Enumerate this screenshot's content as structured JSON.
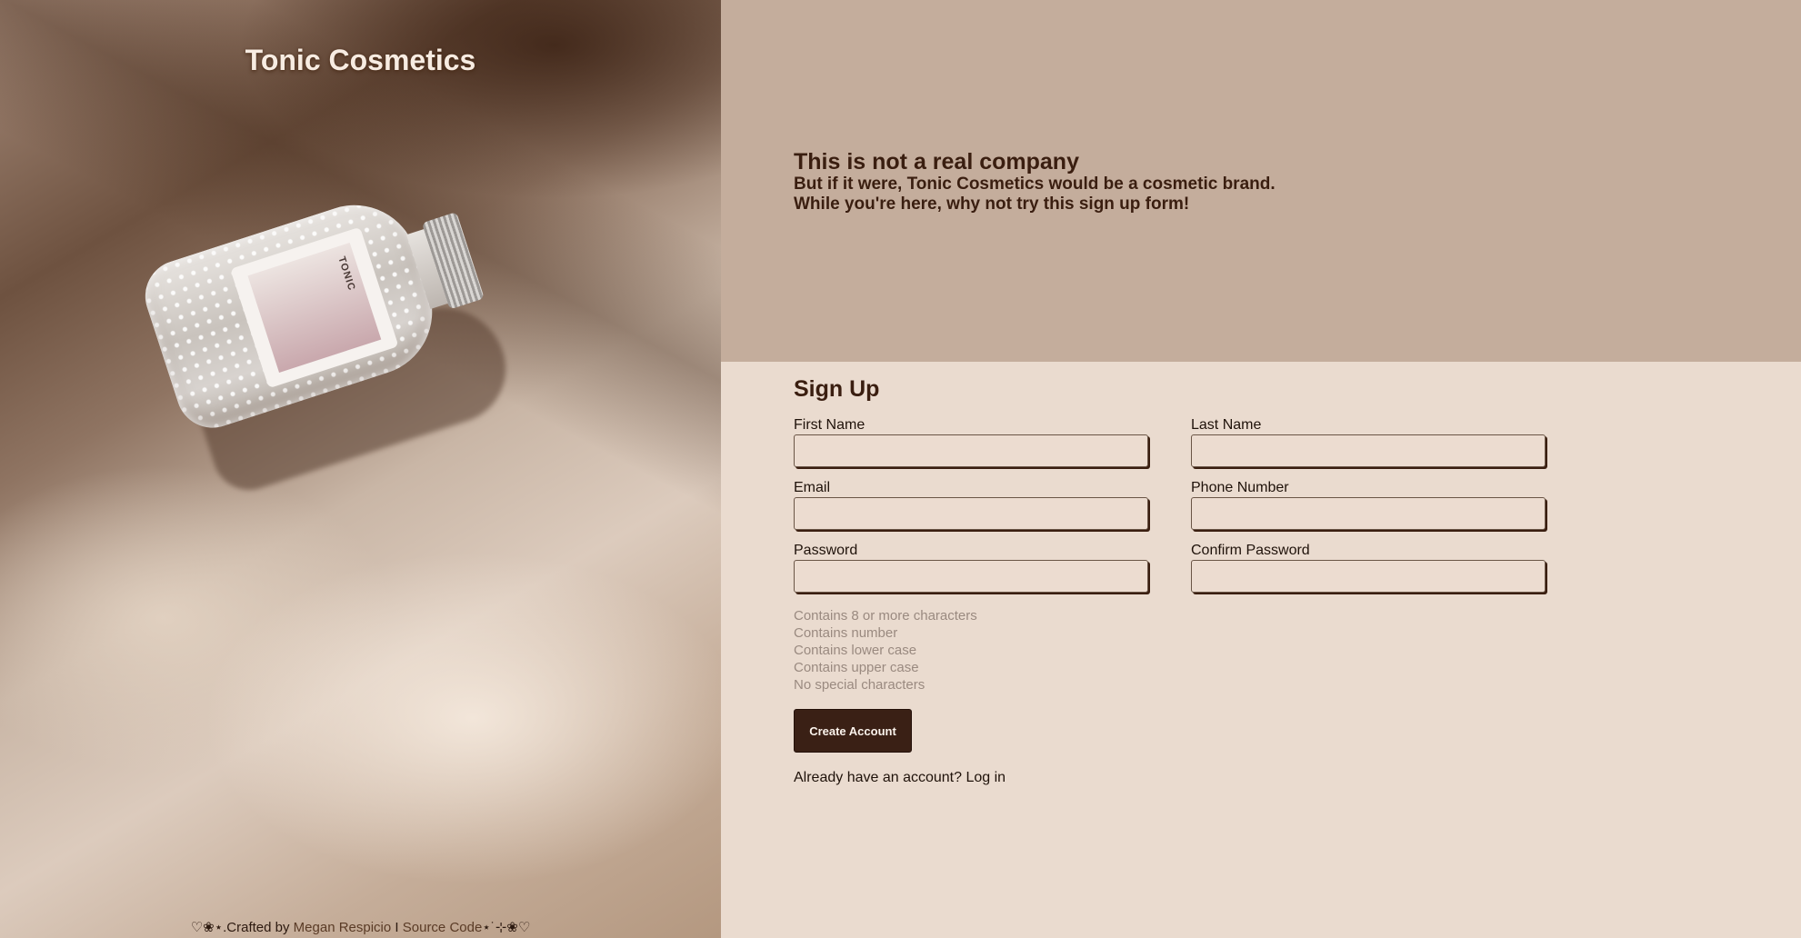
{
  "hero": {
    "brand": "Tonic Cosmetics",
    "bottle_label": "TONIC",
    "credit": {
      "prefix": "♡❀⋆.Crafted by ",
      "author": "Megan Respicio",
      "separator": " I ",
      "source": "Source Code",
      "suffix": "⋆˙⊹❀♡"
    }
  },
  "intro": {
    "title": "This is not a real company",
    "line1": "But if it were, Tonic Cosmetics would be a cosmetic brand.",
    "line2": "While you're here, why not try this sign up form!"
  },
  "form": {
    "title": "Sign Up",
    "first_name": {
      "label": "First Name",
      "value": ""
    },
    "last_name": {
      "label": "Last Name",
      "value": ""
    },
    "email": {
      "label": "Email",
      "value": ""
    },
    "phone": {
      "label": "Phone Number",
      "value": ""
    },
    "password": {
      "label": "Password",
      "value": ""
    },
    "confirm_password": {
      "label": "Confirm Password",
      "value": ""
    },
    "rules": [
      "Contains 8 or more characters",
      "Contains number",
      "Contains lower case",
      "Contains upper case",
      "No special characters"
    ],
    "submit_label": "Create Account",
    "login_prompt": "Already have an account? ",
    "login_link": "Log in"
  },
  "colors": {
    "intro_bg": "#c4ad9c",
    "form_bg": "#eadbcf",
    "heading": "#3a1e10",
    "button_bg": "#3a2015",
    "rule_text": "#9a8a80"
  }
}
